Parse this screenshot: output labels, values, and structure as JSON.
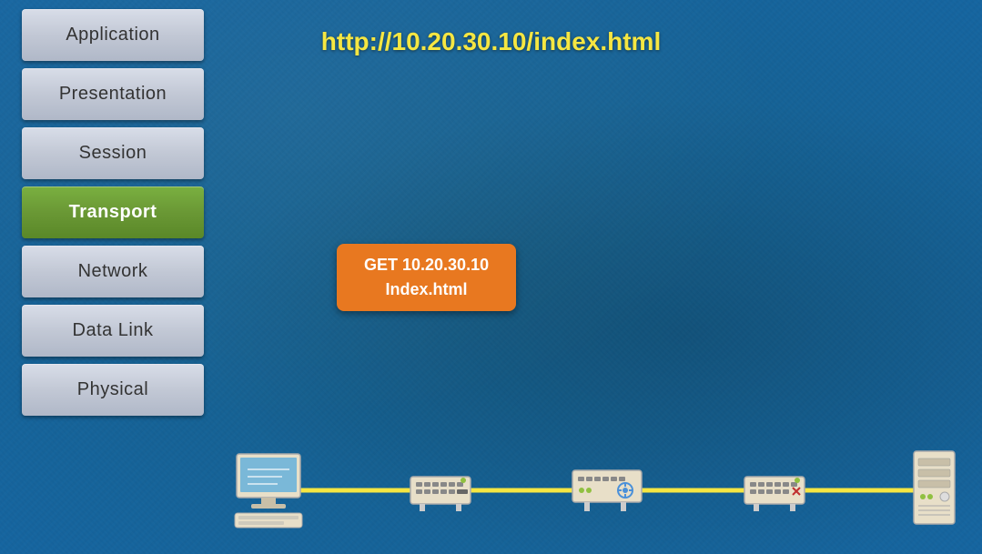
{
  "url": {
    "text": "http://10.20.30.10/index.html"
  },
  "packet": {
    "line1": "GET 10.20.30.10",
    "line2": "Index.html"
  },
  "layers": [
    {
      "id": "application",
      "label": "Application",
      "active": false
    },
    {
      "id": "presentation",
      "label": "Presentation",
      "active": false
    },
    {
      "id": "session",
      "label": "Session",
      "active": false
    },
    {
      "id": "transport",
      "label": "Transport",
      "active": true
    },
    {
      "id": "network",
      "label": "Network",
      "active": false
    },
    {
      "id": "data-link",
      "label": "Data Link",
      "active": false
    },
    {
      "id": "physical",
      "label": "Physical",
      "active": false
    }
  ],
  "colors": {
    "url": "#f5e642",
    "packet_bg": "#e87820",
    "active_btn": "#6a9835",
    "cable": "#f5e642"
  }
}
